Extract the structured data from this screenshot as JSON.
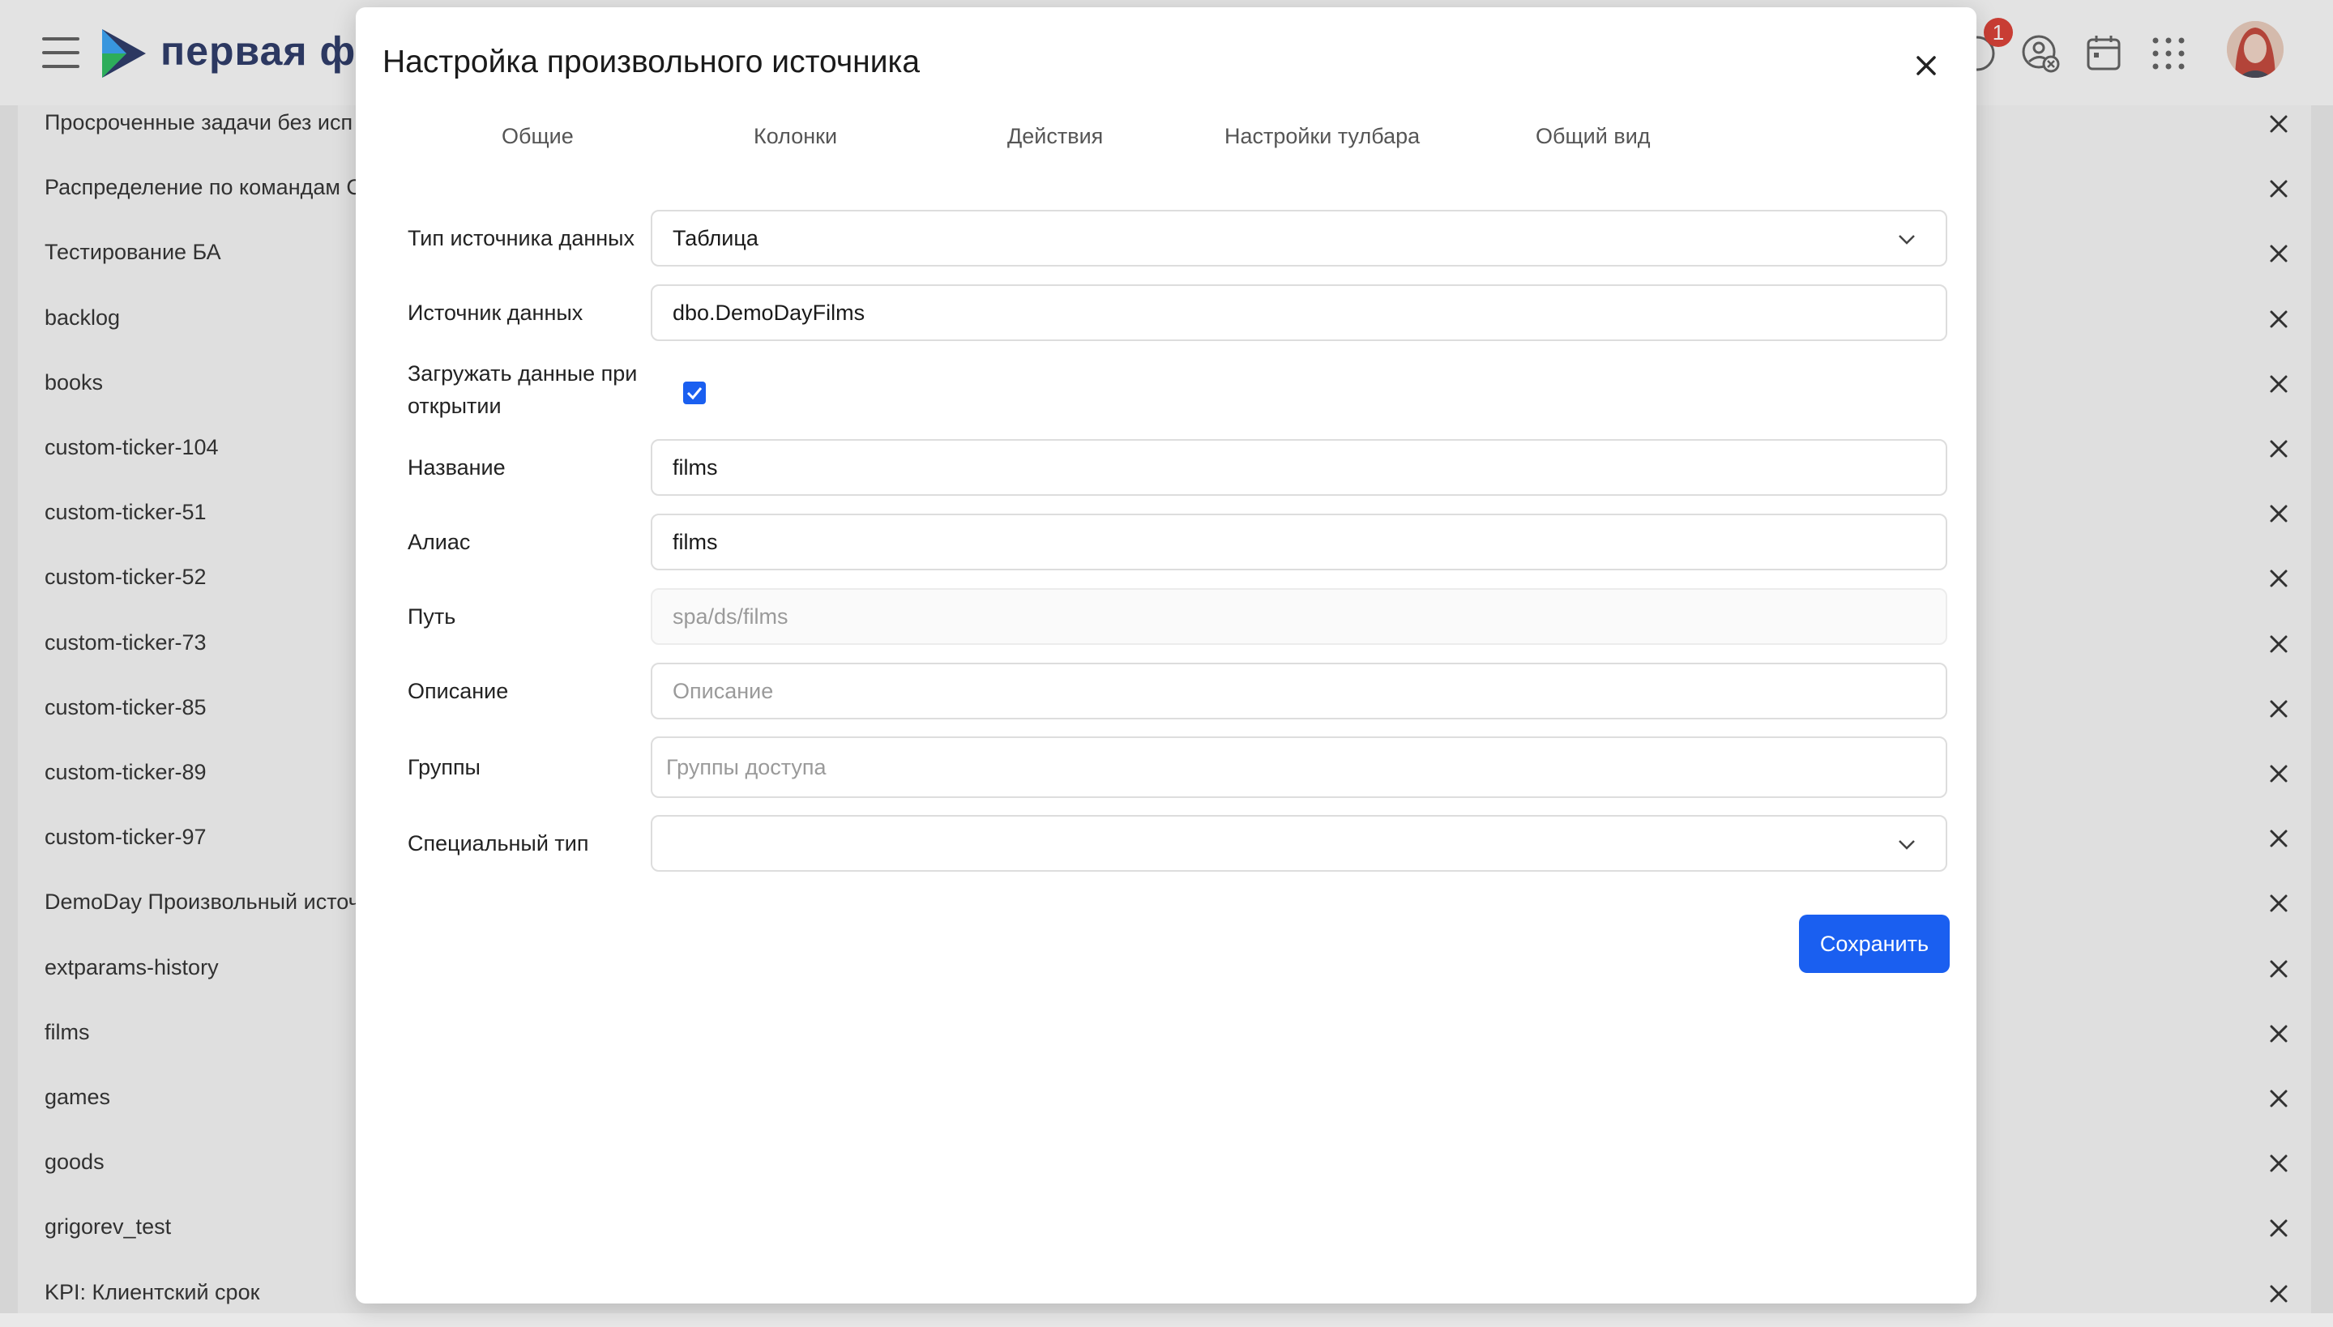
{
  "header": {
    "brand": "первая фор",
    "notification_count": "1"
  },
  "list": {
    "items": [
      "Просроченные задачи без исп",
      "Распределение по командам С",
      "Тестирование БА",
      "backlog",
      "books",
      "custom-ticker-104",
      "custom-ticker-51",
      "custom-ticker-52",
      "custom-ticker-73",
      "custom-ticker-85",
      "custom-ticker-89",
      "custom-ticker-97",
      "DemoDay Произвольный источ",
      "extparams-history",
      "films",
      "games",
      "goods",
      "grigorev_test",
      "KPI: Клиентский срок"
    ]
  },
  "modal": {
    "title": "Настройка произвольного источника",
    "tabs": [
      "Общие",
      "Колонки",
      "Действия",
      "Настройки тулбара",
      "Общий вид"
    ],
    "form": {
      "source_type": {
        "label": "Тип источника данных",
        "value": "Таблица"
      },
      "source": {
        "label": "Источник данных",
        "value": "dbo.DemoDayFilms"
      },
      "load_on_open": {
        "label": "Загружать данные при открытии",
        "checked": true
      },
      "name": {
        "label": "Название",
        "value": "films"
      },
      "alias": {
        "label": "Алиас",
        "value": "films"
      },
      "path": {
        "label": "Путь",
        "placeholder": "spa/ds/films"
      },
      "description": {
        "label": "Описание",
        "placeholder": "Описание"
      },
      "groups": {
        "label": "Группы",
        "placeholder": "Группы доступа"
      },
      "special_type": {
        "label": "Специальный тип",
        "value": ""
      }
    },
    "save_label": "Сохранить"
  },
  "colors": {
    "accent": "#1a5ff0",
    "badge": "#d93025",
    "brand": "#1c2a5c"
  }
}
